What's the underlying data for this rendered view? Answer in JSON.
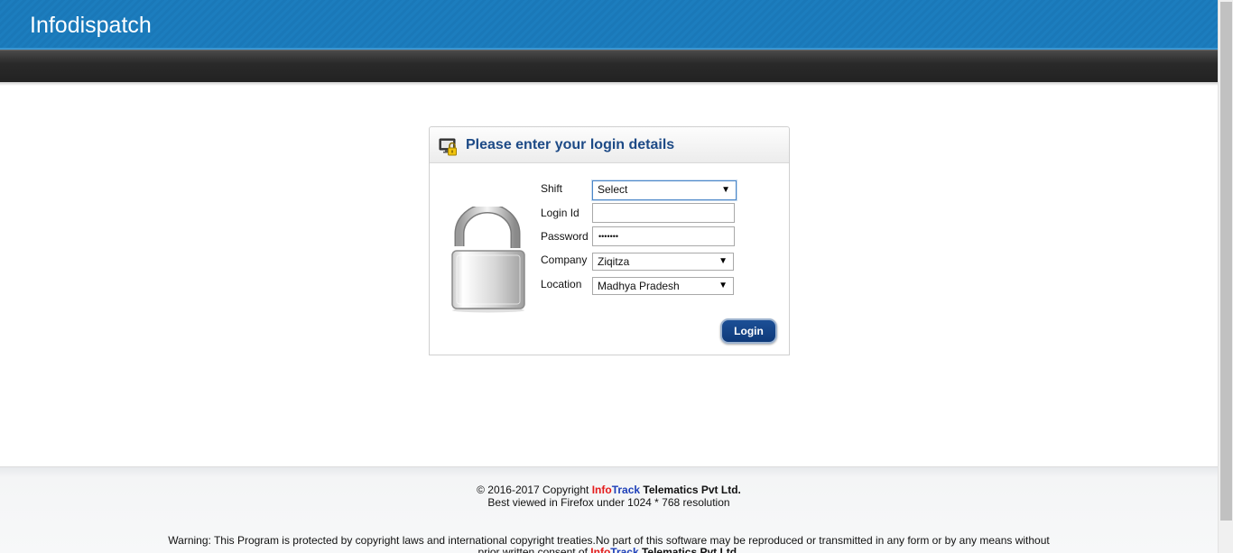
{
  "header": {
    "brand": "Infodispatch"
  },
  "login": {
    "title": "Please enter your login details",
    "fields": {
      "shift": {
        "label": "Shift",
        "value": "Select"
      },
      "login_id": {
        "label": "Login Id",
        "value": ""
      },
      "password": {
        "label": "Password",
        "value": "•••••••"
      },
      "company": {
        "label": "Company",
        "value": "Ziqitza"
      },
      "location": {
        "label": "Location",
        "value": "Madhya Pradesh"
      }
    },
    "button": "Login"
  },
  "footer": {
    "copyright_prefix": "© 2016-2017 Copyright ",
    "brand_info": "Info",
    "brand_track": "Track",
    "brand_rest": " Telematics Pvt Ltd.",
    "resolution": "Best viewed in Firefox under 1024 * 768 resolution",
    "warning": "Warning: This Program is protected by copyright laws and international copyright treaties.No part of this software may be reproduced or transmitted in any form or by any means without",
    "warning2_prefix": "prior written consent of ",
    "warning2_rest": " Telematics Pvt Ltd."
  },
  "colors": {
    "header_blue": "#1a78b8",
    "title_blue": "#1d4a86",
    "button_blue": "#0e3a7a",
    "info_red": "#e41b1b",
    "track_blue": "#1d3fb8"
  },
  "icons": {
    "header": "monitor-lock-icon",
    "lock": "padlock-open-icon",
    "caret": "triangle-down"
  }
}
